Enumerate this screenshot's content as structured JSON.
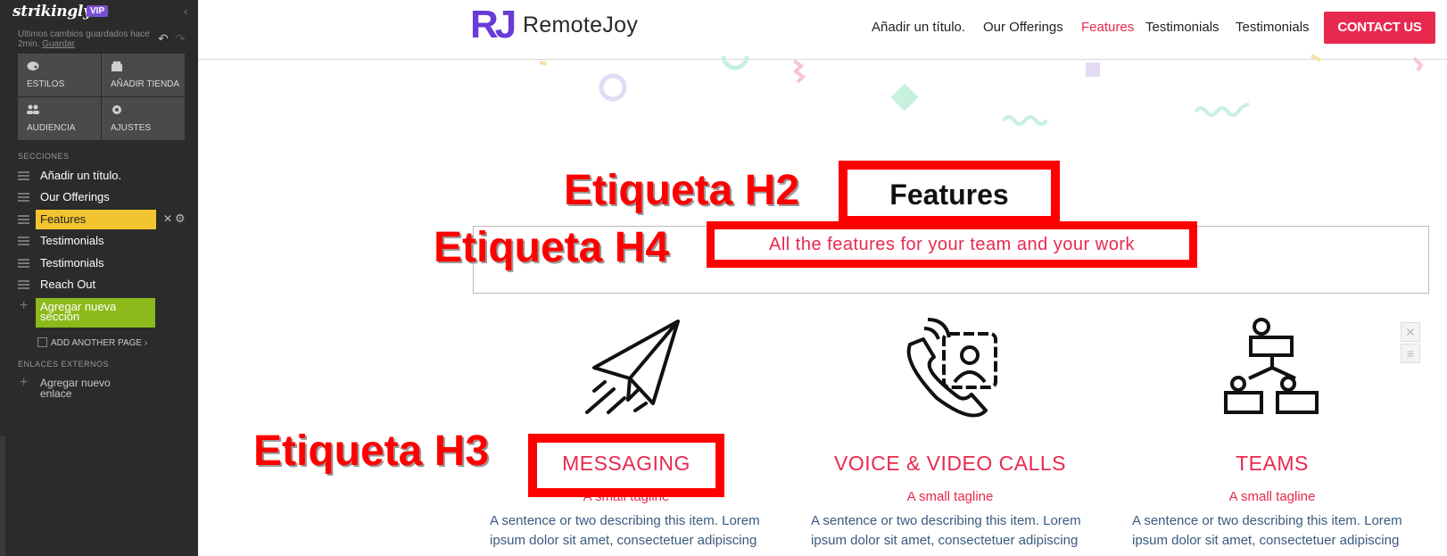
{
  "sidebar": {
    "logo": "strikingly",
    "badge": "VIP",
    "saved_text": "Ultimos cambios guardados hace 2min.",
    "save_link": "Guardar",
    "tools": [
      {
        "icon": "palette-icon",
        "label": "ESTILOS"
      },
      {
        "icon": "store-icon",
        "label": "AÑADIR TIENDA"
      },
      {
        "icon": "audience-icon",
        "label": "AUDIENCIA"
      },
      {
        "icon": "gear-icon",
        "label": "AJUSTES"
      }
    ],
    "sections_heading": "SECCIONES",
    "sections": [
      {
        "label": "Añadir un título."
      },
      {
        "label": "Our Offerings"
      },
      {
        "label": "Features"
      },
      {
        "label": "Testimonials"
      },
      {
        "label": "Testimonials"
      },
      {
        "label": "Reach Out"
      }
    ],
    "add_section": "Agregar nueva sección",
    "add_page": "ADD ANOTHER PAGE ›",
    "external_heading": "ENLACES EXTERNOS",
    "add_link": "Agregar nuevo enlace"
  },
  "header": {
    "brand_mark": "RJ",
    "brand_name": "RemoteJoy",
    "nav": [
      {
        "label": "Añadir un título."
      },
      {
        "label": "Our Offerings"
      },
      {
        "label": "Features"
      },
      {
        "label": "Testimonials"
      },
      {
        "label": "Testimonials"
      }
    ],
    "cta": "CONTACT US"
  },
  "content": {
    "heading": "Features",
    "subheading": "All the features for your team and your work",
    "annotations": {
      "h2": "Etiqueta H2",
      "h4": "Etiqueta H4",
      "h3": "Etiqueta H3"
    },
    "features": [
      {
        "icon": "paper-plane-icon",
        "title": "MESSAGING",
        "tagline": "A small tagline",
        "desc1": "A sentence or two describing this item. Lorem",
        "desc2": "ipsum dolor sit amet, consectetuer adipiscing"
      },
      {
        "icon": "phone-contact-icon",
        "title": "VOICE & VIDEO CALLS",
        "tagline": "A small tagline",
        "desc1": "A sentence or two describing this item. Lorem",
        "desc2": "ipsum dolor sit amet, consectetuer adipiscing"
      },
      {
        "icon": "team-network-icon",
        "title": "TEAMS",
        "tagline": "A small tagline",
        "desc1": "A sentence or two describing this item. Lorem",
        "desc2": "ipsum dolor sit amet, consectetuer adipiscing"
      }
    ]
  },
  "colors": {
    "accent": "#e8294f",
    "annotation_red": "#ff0000",
    "sidebar_bg": "#2b2b2b",
    "active_section": "#f2c430",
    "add_section_green": "#8cba1a",
    "brand_purple": "#6a3bd8"
  }
}
